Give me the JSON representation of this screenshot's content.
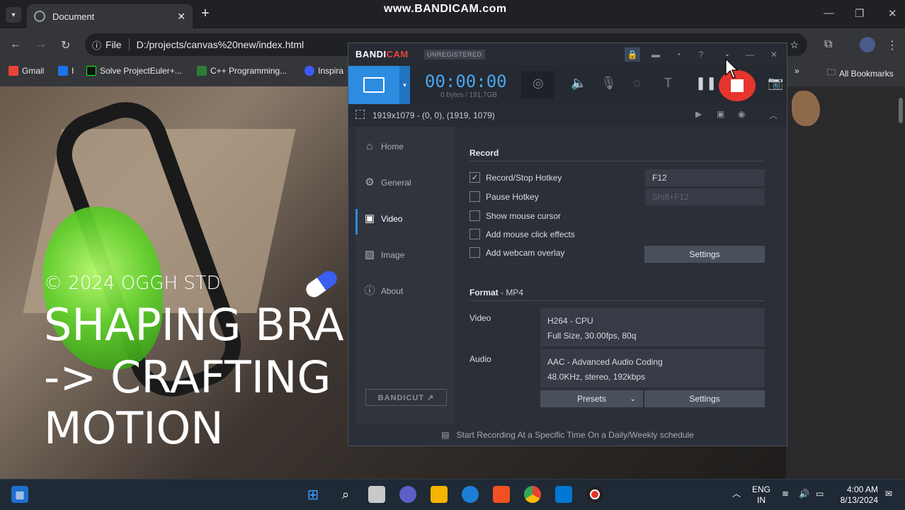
{
  "browser": {
    "tab_title": "Document",
    "tab_close": "✕",
    "new_tab": "+",
    "watermark": "www.BANDICAM.com",
    "omnibox": {
      "info_label": "File",
      "url": "D:/projects/canvas%20new/index.html"
    },
    "bookmarks": [
      "Gmail",
      "I",
      "Solve ProjectEuler+...",
      "C++ Programming...",
      "Inspira"
    ],
    "all_bookmarks": "All Bookmarks"
  },
  "page": {
    "copyright": "© 2024 OGGH STD",
    "hero_lines": [
      "SHAPING BRA",
      "-> CRAFTING",
      "MOTION"
    ]
  },
  "bandicam": {
    "logo_a": "BANDI",
    "logo_b": "CAM",
    "unregistered": "UNREGISTERED",
    "timer": "00:00:00",
    "bytes": "0 bytes / 191.7GB",
    "status_area": "1919x1079 - (0, 0), (1919, 1079)",
    "sidebar": [
      {
        "label": "Home",
        "icon": "home-icon"
      },
      {
        "label": "General",
        "icon": "gear-icon"
      },
      {
        "label": "Video",
        "icon": "video-icon"
      },
      {
        "label": "Image",
        "icon": "image-icon"
      },
      {
        "label": "About",
        "icon": "info-icon"
      }
    ],
    "bandicut": "BANDICUT ↗",
    "record": {
      "heading": "Record",
      "options": [
        {
          "label": "Record/Stop Hotkey",
          "checked": true
        },
        {
          "label": "Pause Hotkey",
          "checked": false
        },
        {
          "label": "Show mouse cursor",
          "checked": false
        },
        {
          "label": "Add mouse click effects",
          "checked": false
        },
        {
          "label": "Add webcam overlay",
          "checked": false
        }
      ],
      "record_hotkey": "F12",
      "pause_hotkey": "Shift+F12",
      "settings_button": "Settings"
    },
    "format": {
      "heading": "Format",
      "container": " - MP4",
      "video_label": "Video",
      "video_codec": "H264 - CPU",
      "video_detail": "Full Size, 30.00fps, 80q",
      "audio_label": "Audio",
      "audio_codec": "AAC - Advanced Audio Coding",
      "audio_detail": "48.0KHz, stereo, 192kbps",
      "presets_button": "Presets",
      "settings_button": "Settings"
    },
    "footer": "Start Recording At a Specific Time On a Daily/Weekly schedule"
  },
  "taskbar": {
    "lang_top": "ENG",
    "lang_bottom": "IN",
    "time": "4:00 AM",
    "date": "8/13/2024"
  }
}
